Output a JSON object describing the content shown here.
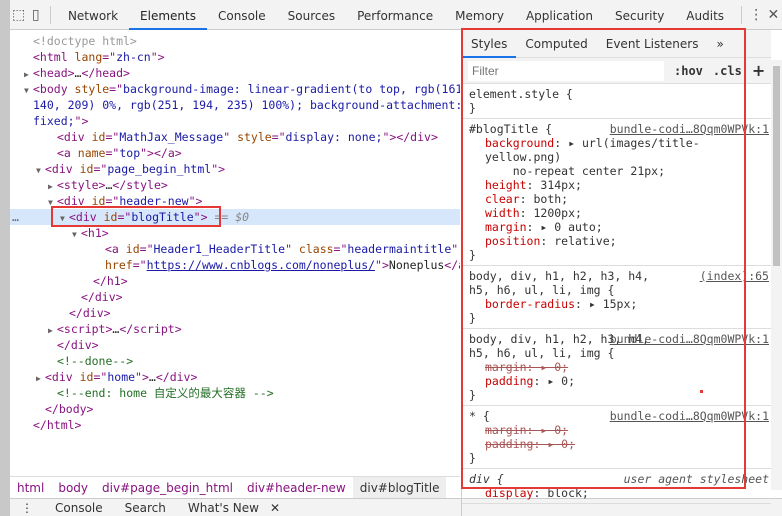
{
  "toolbar": {
    "tabs": [
      "Network",
      "Elements",
      "Console",
      "Sources",
      "Performance",
      "Memory",
      "Application",
      "Security",
      "Audits"
    ],
    "active": "Elements"
  },
  "dom": {
    "lines": [
      {
        "i": 0,
        "a": "",
        "tk": [
          [
            "dim",
            "<!doctype html>"
          ]
        ]
      },
      {
        "i": 0,
        "a": "",
        "tk": [
          [
            "tag",
            "<html "
          ],
          [
            "attr",
            "lang"
          ],
          [
            "tag",
            "=\""
          ],
          [
            "val",
            "zh-cn"
          ],
          [
            "tag",
            "\">"
          ]
        ]
      },
      {
        "i": 0,
        "a": "▶",
        "tk": [
          [
            "tag",
            "<head>"
          ],
          [
            "text",
            "…"
          ],
          [
            "tag",
            "</head>"
          ]
        ]
      },
      {
        "i": 0,
        "a": "▼",
        "tk": [
          [
            "tag",
            "<body "
          ],
          [
            "attr",
            "style"
          ],
          [
            "tag",
            "=\""
          ],
          [
            "val",
            "background-image: linear-gradient(to top, rgb(161,"
          ]
        ]
      },
      {
        "i": 0,
        "a": "",
        "tk": [
          [
            "val",
            "140, 209) 0%, rgb(251, 194, 235) 100%); background-attachment:"
          ]
        ]
      },
      {
        "i": 0,
        "a": "",
        "tk": [
          [
            "val",
            "fixed;"
          ],
          [
            "tag",
            "\">"
          ]
        ]
      },
      {
        "i": 2,
        "a": "",
        "tk": [
          [
            "tag",
            "<div "
          ],
          [
            "attr",
            "id"
          ],
          [
            "tag",
            "=\""
          ],
          [
            "val",
            "MathJax_Message"
          ],
          [
            "tag",
            "\" "
          ],
          [
            "attr",
            "style"
          ],
          [
            "tag",
            "=\""
          ],
          [
            "val",
            "display: none;"
          ],
          [
            "tag",
            "\"></div>"
          ]
        ]
      },
      {
        "i": 2,
        "a": "",
        "tk": [
          [
            "tag",
            "<a "
          ],
          [
            "attr",
            "name"
          ],
          [
            "tag",
            "=\""
          ],
          [
            "val",
            "top"
          ],
          [
            "tag",
            "\"></a>"
          ]
        ]
      },
      {
        "i": 1,
        "a": "▼",
        "tk": [
          [
            "tag",
            "<div "
          ],
          [
            "attr",
            "id"
          ],
          [
            "tag",
            "=\""
          ],
          [
            "val",
            "page_begin_html"
          ],
          [
            "tag",
            "\">"
          ]
        ]
      },
      {
        "i": 2,
        "a": "▶",
        "tk": [
          [
            "tag",
            "<style>"
          ],
          [
            "text",
            "…"
          ],
          [
            "tag",
            "</style>"
          ]
        ]
      },
      {
        "i": 2,
        "a": "▼",
        "tk": [
          [
            "tag",
            "<div "
          ],
          [
            "attr",
            "id"
          ],
          [
            "tag",
            "=\""
          ],
          [
            "val",
            "header-new"
          ],
          [
            "tag",
            "\">"
          ]
        ]
      },
      {
        "i": 3,
        "a": "▼",
        "sel": true,
        "tk": [
          [
            "tag",
            "<div "
          ],
          [
            "attr",
            "id"
          ],
          [
            "tag",
            "=\""
          ],
          [
            "val",
            "blogTitle"
          ],
          [
            "tag",
            "\">"
          ],
          [
            "eq",
            " == $0"
          ]
        ]
      },
      {
        "i": 4,
        "a": "▼",
        "tk": [
          [
            "tag",
            "<h1>"
          ]
        ]
      },
      {
        "i": 6,
        "a": "",
        "tk": [
          [
            "tag",
            "<a "
          ],
          [
            "attr",
            "id"
          ],
          [
            "tag",
            "=\""
          ],
          [
            "val",
            "Header1_HeaderTitle"
          ],
          [
            "tag",
            "\" "
          ],
          [
            "attr",
            "class"
          ],
          [
            "tag",
            "=\""
          ],
          [
            "val",
            "headermaintitle"
          ],
          [
            "tag",
            "\""
          ]
        ]
      },
      {
        "i": 6,
        "a": "",
        "tk": [
          [
            "attr",
            "href"
          ],
          [
            "tag",
            "=\""
          ],
          [
            "link",
            "https://www.cnblogs.com/noneplus/"
          ],
          [
            "tag",
            "\">"
          ],
          [
            "text",
            "Noneplus"
          ],
          [
            "tag",
            "</a>"
          ]
        ]
      },
      {
        "i": 5,
        "a": "",
        "tk": [
          [
            "tag",
            "</h1>"
          ]
        ]
      },
      {
        "i": 4,
        "a": "",
        "tk": [
          [
            "tag",
            "</div>"
          ]
        ]
      },
      {
        "i": 3,
        "a": "",
        "tk": [
          [
            "tag",
            "</div>"
          ]
        ]
      },
      {
        "i": 2,
        "a": "▶",
        "tk": [
          [
            "tag",
            "<script>"
          ],
          [
            "text",
            "…"
          ],
          [
            "tag",
            "</script>"
          ]
        ]
      },
      {
        "i": 2,
        "a": "",
        "tk": [
          [
            "tag",
            "</div>"
          ]
        ]
      },
      {
        "i": 2,
        "a": "",
        "tk": [
          [
            "comment",
            "<!--done-->"
          ]
        ]
      },
      {
        "i": 1,
        "a": "▶",
        "tk": [
          [
            "tag",
            "<div "
          ],
          [
            "attr",
            "id"
          ],
          [
            "tag",
            "=\""
          ],
          [
            "val",
            "home"
          ],
          [
            "tag",
            "\">"
          ],
          [
            "text",
            "…"
          ],
          [
            "tag",
            "</div>"
          ]
        ]
      },
      {
        "i": 2,
        "a": "",
        "tk": [
          [
            "comment",
            "<!--end: home 自定义的最大容器 -->"
          ]
        ]
      },
      {
        "i": 1,
        "a": "",
        "tk": [
          [
            "tag",
            "</body>"
          ]
        ]
      },
      {
        "i": 0,
        "a": "",
        "tk": [
          [
            "tag",
            "</html>"
          ]
        ]
      }
    ]
  },
  "breadcrumb": [
    "html",
    "body",
    "div#page_begin_html",
    "div#header-new",
    "div#blogTitle"
  ],
  "drawer": {
    "tabs": [
      "Console",
      "Search",
      "What's New"
    ]
  },
  "styles": {
    "tabs": [
      "Styles",
      "Computed",
      "Event Listeners",
      "»"
    ],
    "filter_placeholder": "Filter",
    "hov": ":hov",
    "cls": ".cls",
    "add": "+",
    "rules": [
      {
        "sel": "element.style {",
        "src": "",
        "props": []
      },
      {
        "sel": "#blogTitle {",
        "src": "bundle-codi…8Qqm0WPVk:1",
        "props": [
          [
            "background",
            ": ▸ url(images/title-yellow.png)",
            false
          ],
          [
            "",
            "    no-repeat center 21px;",
            false
          ],
          [
            "height",
            ": 314px;",
            false
          ],
          [
            "clear",
            ": both;",
            false
          ],
          [
            "width",
            ": 1200px;",
            false
          ],
          [
            "margin",
            ": ▸ 0 auto;",
            false
          ],
          [
            "position",
            ": relative;",
            false
          ]
        ]
      },
      {
        "sel": "body, div, h1, h2, h3, h4, h5, h6, ul, li, img {",
        "src": "(index):65",
        "props": [
          [
            "border-radius",
            ": ▸ 15px;",
            false
          ]
        ]
      },
      {
        "sel": "body, div, h1, h2, h3, h4, h5, h6, ul, li, img {",
        "src": "bundle-codi…8Qqm0WPVk:1",
        "props": [
          [
            "margin",
            ": ▸ 0;",
            true
          ],
          [
            "padding",
            ": ▸ 0;",
            false
          ]
        ]
      },
      {
        "sel": "* {",
        "src": "bundle-codi…8Qqm0WPVk:1",
        "props": [
          [
            "margin",
            ": ▸ 0;",
            true
          ],
          [
            "padding",
            ": ▸ 0;",
            true
          ]
        ]
      },
      {
        "sel": "div {",
        "src": "user agent stylesheet",
        "ua": true,
        "props": [
          [
            "display",
            ": block;",
            false
          ]
        ]
      }
    ]
  }
}
